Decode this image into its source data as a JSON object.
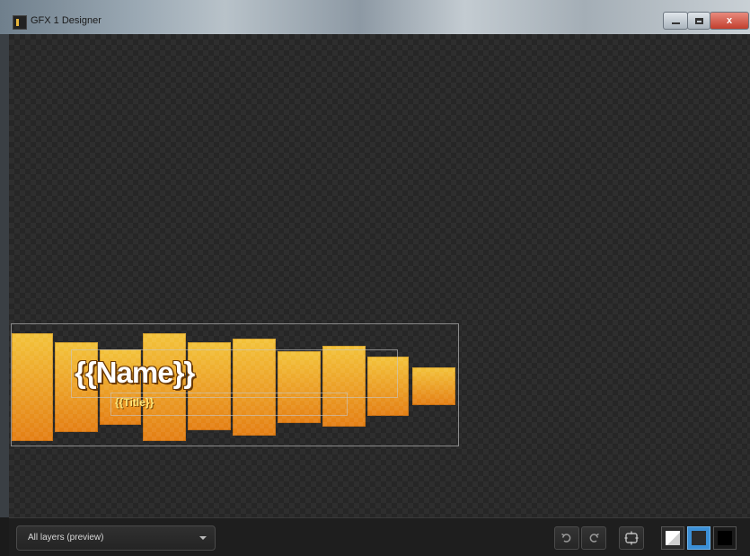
{
  "window": {
    "title": "GFX 1 Designer",
    "icon": "app-icon",
    "buttons": {
      "minimize": "minimize-icon",
      "maximize": "maximize-icon",
      "close": "x"
    }
  },
  "canvas": {
    "name_placeholder": "{{Name}}",
    "title_placeholder": "{{Title}}",
    "bar_gradient": [
      "#f3c33a",
      "#e47f14"
    ]
  },
  "toolbar": {
    "layer_select_value": "All layers (preview)",
    "undo_icon": "undo-icon",
    "redo_icon": "redo-icon",
    "fit_icon": "fit-to-screen-icon",
    "backgrounds": [
      "white",
      "dark",
      "black"
    ],
    "active_background": "dark"
  }
}
